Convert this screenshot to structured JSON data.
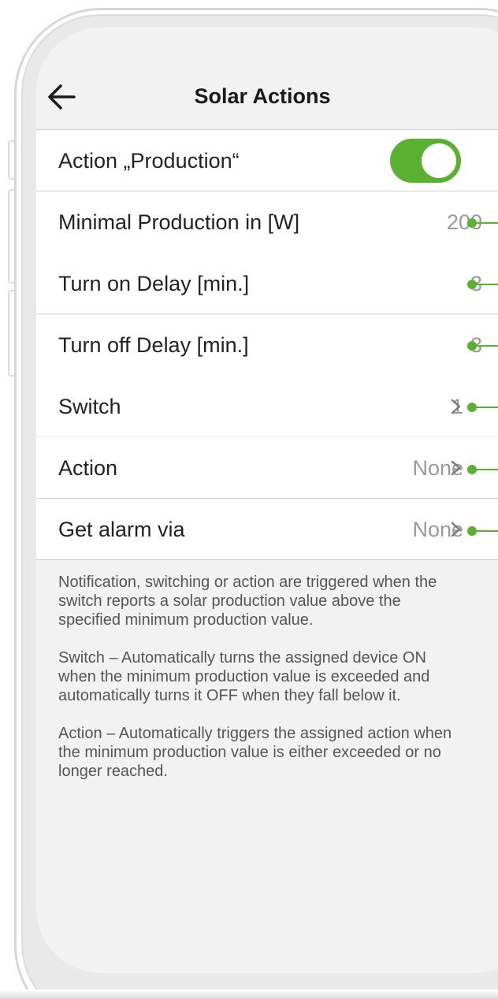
{
  "header": {
    "title": "Solar Actions"
  },
  "rows": [
    {
      "label": "Action „Production“",
      "toggle_state": "on"
    },
    {
      "label": "Minimal Production in [W]",
      "value": "200"
    },
    {
      "label": "Turn on Delay [min.]",
      "value": "3"
    },
    {
      "label": "Turn off Delay [min.]",
      "value": "3"
    },
    {
      "label": "Switch",
      "value": "1"
    },
    {
      "label": "Action",
      "value": "None"
    },
    {
      "label": "Get alarm via",
      "value": "None"
    }
  ],
  "description": {
    "p1": "Notification, switching or action are triggered when the switch reports a solar production value above the specified minimum production value.",
    "p2": "Switch – Automatically turns the assigned device ON when the minimum production value is exceeded and automatically turns it OFF when they fall below it.",
    "p3": "Action – Automatically triggers the assigned action when the minimum production value is either exceeded or no longer reached."
  },
  "colors": {
    "accent": "#5ab031",
    "background": "#f2f2f2",
    "value_text": "#9a9a9a"
  },
  "icons": {
    "back": "back-arrow-icon",
    "chevron": "chevron-right-icon"
  }
}
